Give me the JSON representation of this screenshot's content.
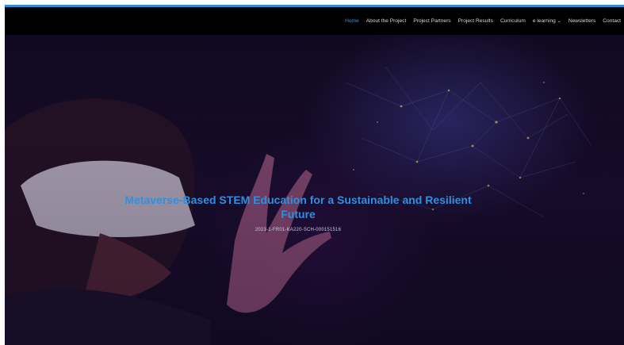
{
  "nav": {
    "items": [
      {
        "label": "Home",
        "active": true
      },
      {
        "label": "About the Project",
        "active": false
      },
      {
        "label": "Project Partners",
        "active": false
      },
      {
        "label": "Project Results",
        "active": false
      },
      {
        "label": "Curriculum",
        "active": false
      },
      {
        "label": "e learning",
        "active": false,
        "dropdown": true
      },
      {
        "label": "Newsletters",
        "active": false
      },
      {
        "label": "Contact",
        "active": false
      }
    ]
  },
  "hero": {
    "title": "Metaverse-Based STEM Education for a Sustainable and Resilient Future",
    "subtitle": "2023-1-FR01-KA220-SCH-000151516"
  },
  "colors": {
    "accent": "#2e8bd8",
    "header_bg": "#000000"
  }
}
